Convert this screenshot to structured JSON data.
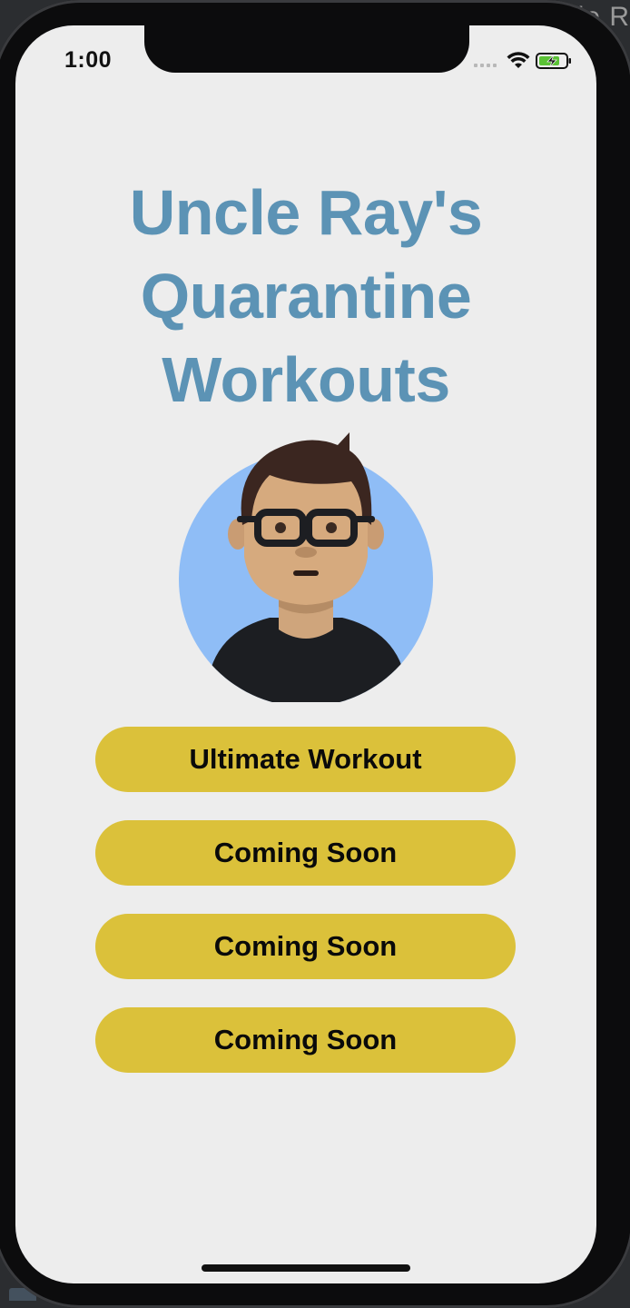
{
  "desktop": {
    "partial_text": "le R"
  },
  "status_bar": {
    "time": "1:00",
    "icons": [
      "cellular-signal-icon",
      "wifi-icon",
      "battery-charging-icon"
    ],
    "battery_color": "#5bc236"
  },
  "main": {
    "title_lines": [
      "Uncle Ray's",
      "Quarantine",
      "Workouts"
    ],
    "title_color": "#5c93b5",
    "avatar": "cartoon-avatar-with-glasses",
    "buttons": [
      {
        "label": "Ultimate Workout"
      },
      {
        "label": "Coming Soon"
      },
      {
        "label": "Coming Soon"
      },
      {
        "label": "Coming Soon"
      }
    ],
    "button_color": "#dbc13a"
  }
}
